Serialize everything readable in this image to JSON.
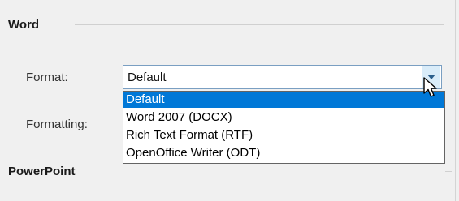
{
  "word": {
    "title": "Word"
  },
  "format": {
    "label": "Format:",
    "value": "Default",
    "options": [
      "Default",
      "Word 2007 (DOCX)",
      "Rich Text Format (RTF)",
      "OpenOffice Writer (ODT)"
    ],
    "highlighted_index": 0
  },
  "formatting": {
    "label": "Formatting:"
  },
  "powerpoint": {
    "title": "PowerPoint"
  },
  "colors": {
    "selection": "#0078d7",
    "combo_border": "#7a9fc2",
    "panel_background": "#f0f0f0"
  },
  "icons": {
    "dropdown": "chevron-down-icon",
    "pointer": "mouse-pointer-icon"
  }
}
